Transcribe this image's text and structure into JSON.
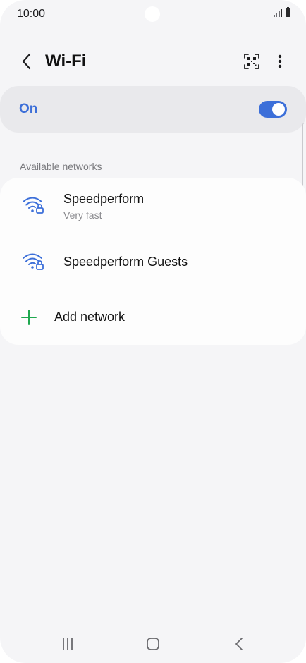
{
  "status_bar": {
    "time": "10:00"
  },
  "header": {
    "title": "Wi-Fi"
  },
  "wifi_toggle": {
    "label": "On",
    "state": "on",
    "accent_color": "#3c6fd9"
  },
  "section": {
    "label": "Available networks"
  },
  "networks": [
    {
      "name": "Speedperform",
      "subtitle": "Very fast",
      "icon": "wifi-lock-icon",
      "secured": true
    },
    {
      "name": "Speedperform Guests",
      "subtitle": "",
      "icon": "wifi-lock-icon",
      "secured": true
    }
  ],
  "add_network": {
    "label": "Add network",
    "icon": "plus-icon",
    "icon_color": "#1fa84f"
  },
  "nav_bar": {
    "items": [
      "recent-apps-icon",
      "home-icon",
      "back-icon"
    ]
  }
}
